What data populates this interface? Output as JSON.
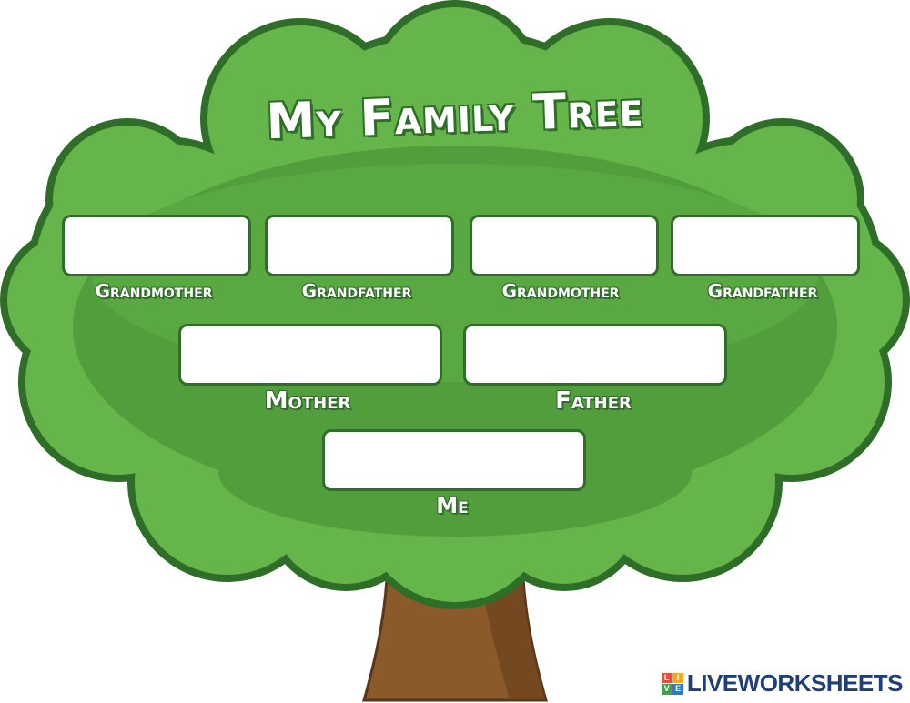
{
  "title": "My Family Tree",
  "labels": {
    "grandmother_1": "Grandmother",
    "grandfather_1": "Grandfather",
    "grandmother_2": "Grandmother",
    "grandfather_2": "Grandfather",
    "mother": "Mother",
    "father": "Father",
    "me": "Me"
  },
  "brand": {
    "name": "LIVEWORKSHEETS",
    "logo_letters": [
      "L",
      "I",
      "V",
      "E"
    ]
  },
  "colors": {
    "foliage_dark": "#2f6e28",
    "foliage_mid": "#4f9a3b",
    "foliage_light": "#66b54a",
    "trunk": "#8a5a2b",
    "trunk_dark": "#6b4220",
    "box_fill": "#ffffff",
    "brand_text": "#1f3f7a"
  }
}
